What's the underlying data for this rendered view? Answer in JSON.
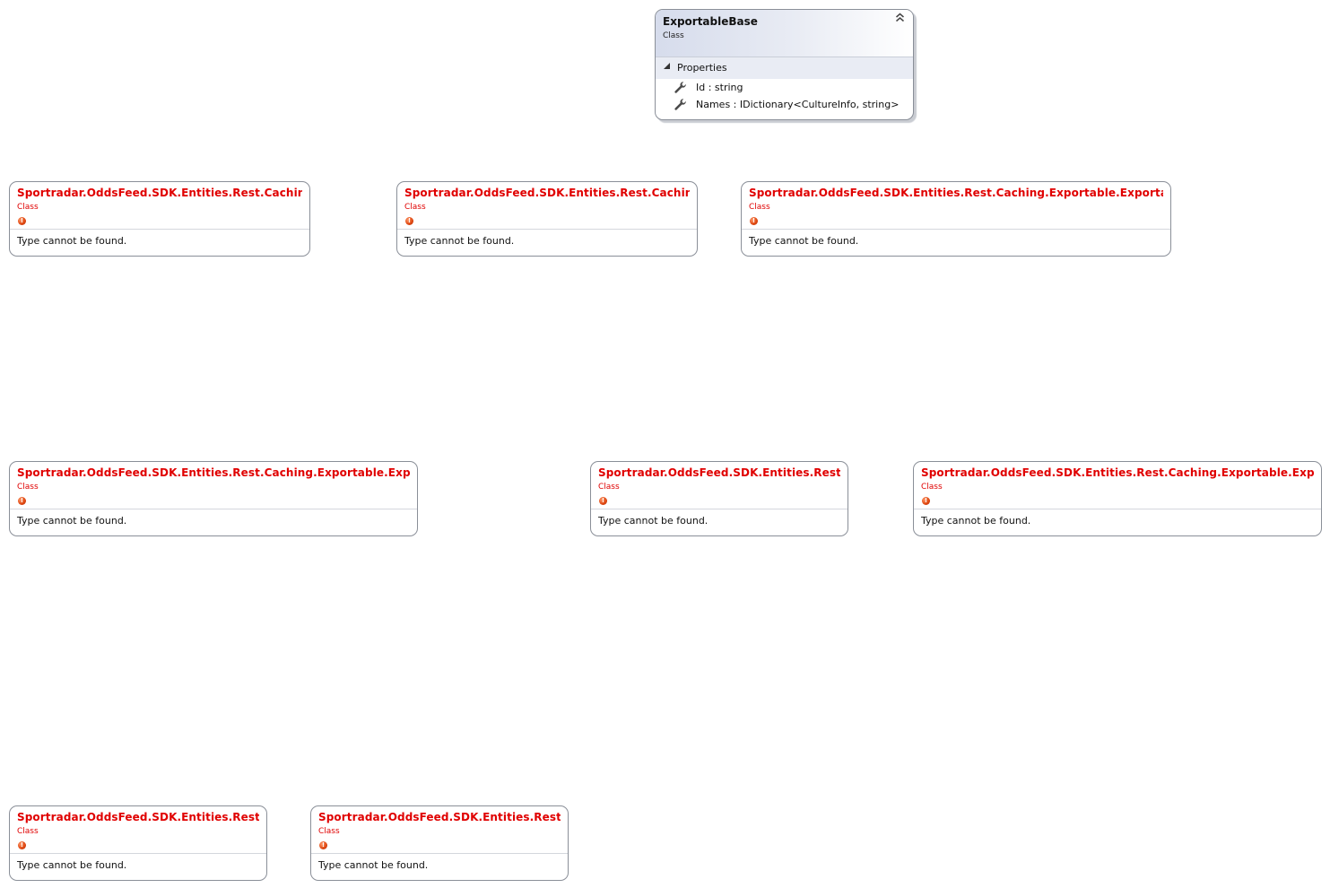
{
  "base_class": {
    "name": "ExportableBase",
    "kind": "Class",
    "collapse_glyph": "⌃⌃",
    "section_toggle_glyph": "◢",
    "section_label": "Properties",
    "properties": [
      {
        "icon": "wrench-icon",
        "text": "Id : string"
      },
      {
        "icon": "wrench-icon",
        "text": "Names : IDictionary<CultureInfo, string>"
      }
    ]
  },
  "missing_types": [
    {
      "title": "Sportradar.OddsFeed.SDK.Entities.Rest.Caching.Expo...",
      "kind": "Class",
      "message": "Type cannot be found."
    },
    {
      "title": "Sportradar.OddsFeed.SDK.Entities.Rest.Caching.Expo...",
      "kind": "Class",
      "message": "Type cannot be found."
    },
    {
      "title": "Sportradar.OddsFeed.SDK.Entities.Rest.Caching.Exportable.ExportableTourna...",
      "kind": "Class",
      "message": "Type cannot be found."
    },
    {
      "title": "Sportradar.OddsFeed.SDK.Entities.Rest.Caching.Exportable.ExportableCo...",
      "kind": "Class",
      "message": "Type cannot be found."
    },
    {
      "title": "Sportradar.OddsFeed.SDK.Entities.Rest.Cach...",
      "kind": "Class",
      "message": "Type cannot be found."
    },
    {
      "title": "Sportradar.OddsFeed.SDK.Entities.Rest.Caching.Exportable.ExportableTo...",
      "kind": "Class",
      "message": "Type cannot be found."
    },
    {
      "title": "Sportradar.OddsFeed.SDK.Entities.Rest.Cach...",
      "kind": "Class",
      "message": "Type cannot be found."
    },
    {
      "title": "Sportradar.OddsFeed.SDK.Entities.Rest.Cach...",
      "kind": "Class",
      "message": "Type cannot be found."
    }
  ],
  "error_icon_glyph": "!",
  "colors": {
    "error_text": "#e00000",
    "header_gradient_start": "#d6dcec",
    "section_background": "#e9ecf4",
    "border": "#8a8f98"
  }
}
